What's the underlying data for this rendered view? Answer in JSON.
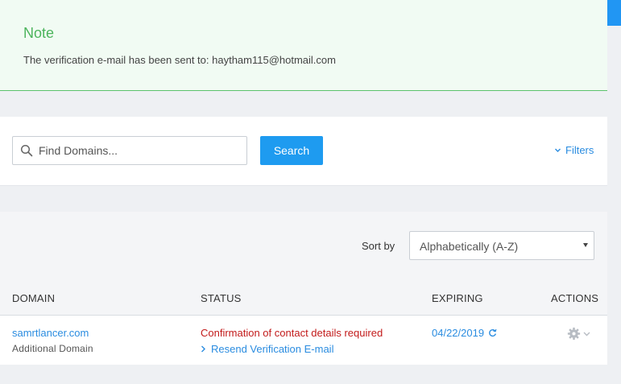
{
  "note": {
    "title": "Note",
    "message": "The verification e-mail has been sent to: haytham115@hotmail.com"
  },
  "search": {
    "placeholder": "Find Domains...",
    "value": "",
    "button_label": "Search",
    "filters_label": "Filters"
  },
  "sort": {
    "label": "Sort by",
    "selected": "Alphabetically (A-Z)"
  },
  "table": {
    "headers": {
      "domain": "DOMAIN",
      "status": "STATUS",
      "expiring": "EXPIRING",
      "actions": "ACTIONS"
    },
    "rows": [
      {
        "domain": "samrtlancer.com",
        "domain_type": "Additional Domain",
        "status": "Confirmation of contact details required",
        "status_action": "Resend Verification E-mail",
        "expiring": "04/22/2019"
      }
    ]
  },
  "icons": {
    "search": "search-icon",
    "filters": "chevron-down-icon",
    "resend": "chevron-right-icon",
    "renew": "refresh-icon",
    "actions": "gear-icon"
  },
  "colors": {
    "note_title": "#4cb45c",
    "note_border": "#5cc26c",
    "primary": "#1e9bf0",
    "link": "#2a8ce0",
    "error": "#c21a1a"
  }
}
